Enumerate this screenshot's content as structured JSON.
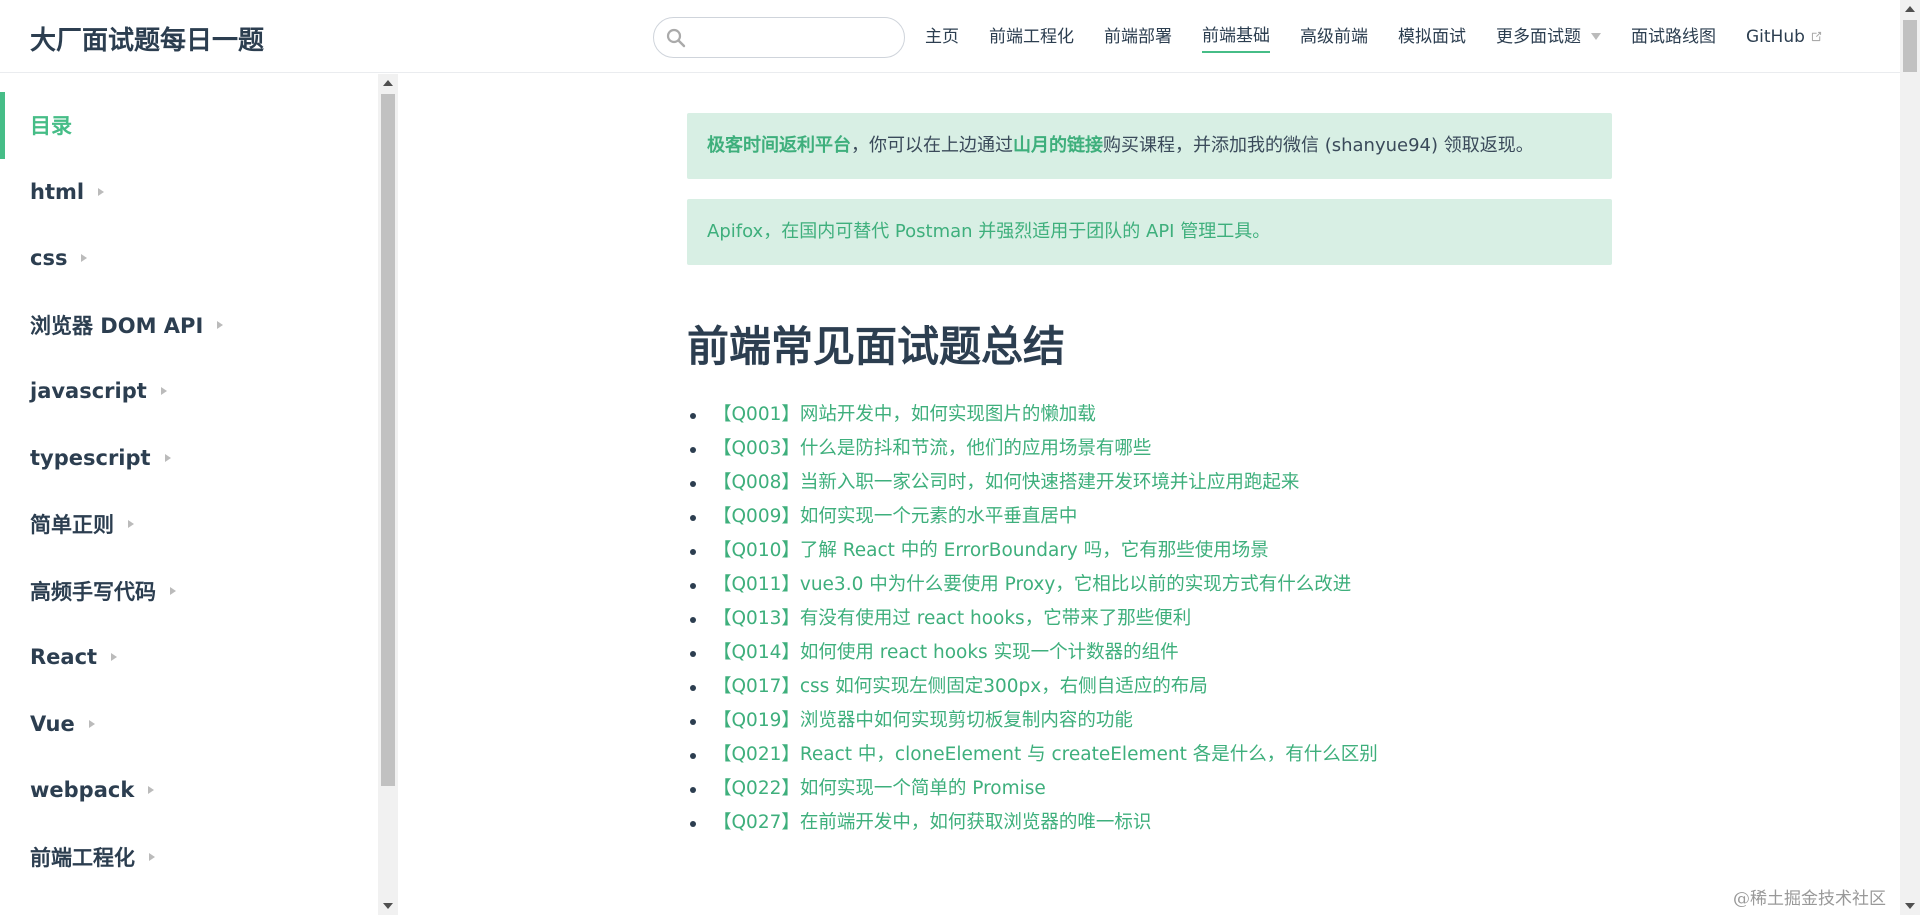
{
  "site": {
    "name": "大厂面试题每日一题"
  },
  "search": {
    "placeholder": "",
    "value": ""
  },
  "nav": {
    "items": [
      {
        "label": "主页"
      },
      {
        "label": "前端工程化"
      },
      {
        "label": "前端部署"
      },
      {
        "label": "前端基础",
        "active": true
      },
      {
        "label": "高级前端"
      },
      {
        "label": "模拟面试"
      },
      {
        "label": "更多面试题"
      },
      {
        "label": "面试路线图"
      },
      {
        "label": "GitHub"
      }
    ]
  },
  "sidebar": {
    "items": [
      {
        "label": "目录",
        "active": true
      },
      {
        "label": "html"
      },
      {
        "label": "css"
      },
      {
        "label": "浏览器 DOM API"
      },
      {
        "label": "javascript"
      },
      {
        "label": "typescript"
      },
      {
        "label": "简单正则"
      },
      {
        "label": "高频手写代码"
      },
      {
        "label": "React"
      },
      {
        "label": "Vue"
      },
      {
        "label": "webpack"
      },
      {
        "label": "前端工程化"
      }
    ]
  },
  "tips": {
    "first": {
      "link1": "极客时间返利平台",
      "text1": "，你可以在上边通过",
      "link2": "山月的链接",
      "text2": "购买课程，并添加我的微信 (shanyue94) 领取返现。"
    },
    "second": {
      "link": "Apifox",
      "text": "，在国内可替代 Postman 并强烈适用于团队的 API 管理工具。"
    }
  },
  "main": {
    "title": "前端常见面试题总结",
    "questions": [
      "【Q001】网站开发中，如何实现图片的懒加载",
      "【Q003】什么是防抖和节流，他们的应用场景有哪些",
      "【Q008】当新入职一家公司时，如何快速搭建开发环境并让应用跑起来",
      "【Q009】如何实现一个元素的水平垂直居中",
      "【Q010】了解 React 中的 ErrorBoundary 吗，它有那些使用场景",
      "【Q011】vue3.0 中为什么要使用 Proxy，它相比以前的实现方式有什么改进",
      "【Q013】有没有使用过 react hooks，它带来了那些便利",
      "【Q014】如何使用 react hooks 实现一个计数器的组件",
      "【Q017】css 如何实现左侧固定300px，右侧自适应的布局",
      "【Q019】浏览器中如何实现剪切板复制内容的功能",
      "【Q021】React 中，cloneElement 与 createElement 各是什么，有什么区别",
      "【Q022】如何实现一个简单的 Promise",
      "【Q027】在前端开发中，如何获取浏览器的唯一标识"
    ]
  },
  "watermark": "@稀土掘金技术社区",
  "colors": {
    "accent": "#3eaf7c",
    "tip_bg": "#d8efe4",
    "text": "#2c3e50"
  }
}
